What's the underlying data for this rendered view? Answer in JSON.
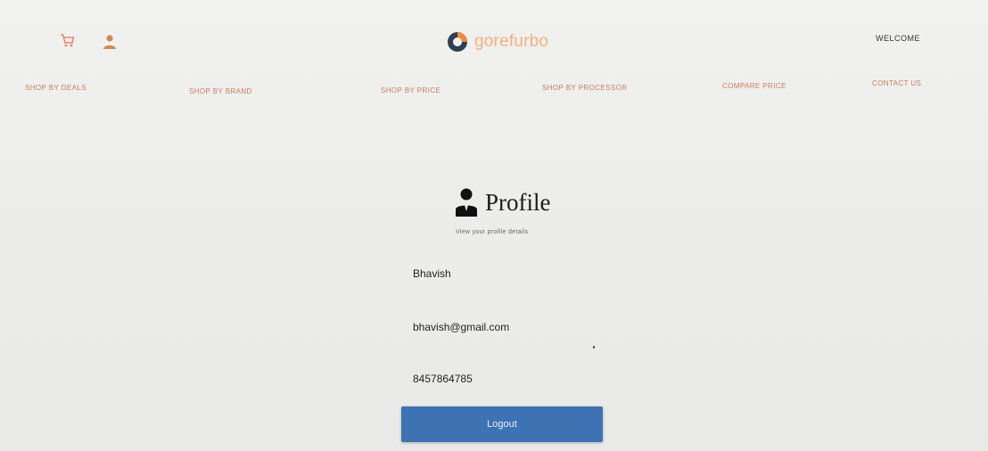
{
  "header": {
    "brand_name": "gorefurbo",
    "account_link": "WELCOME",
    "icons": {
      "cart": "cart-icon",
      "user": "user-icon",
      "logo": "gorefurbo-logo-icon"
    },
    "colors": {
      "brand_text": "#f2b07c",
      "logo_dark": "#2e3f4f",
      "logo_accent": "#f08a3a"
    }
  },
  "nav": {
    "items": [
      {
        "label": "SHOP BY DEALS"
      },
      {
        "label": "SHOP BY BRAND"
      },
      {
        "label": "SHOP BY PRICE"
      },
      {
        "label": "SHOP BY PROCESSOR"
      },
      {
        "label": "COMPARE PRICE"
      },
      {
        "label": "CONTACT US"
      }
    ],
    "color": "#c87d5f"
  },
  "profile": {
    "title": "Profile",
    "subtitle": "View your profile details",
    "name": "Bhavish",
    "email": "bhavish@gmail.com",
    "phone": "8457864785",
    "icon": "person-icon"
  },
  "actions": {
    "logout_label": "Logout",
    "logout_color": "#3d73b2"
  }
}
